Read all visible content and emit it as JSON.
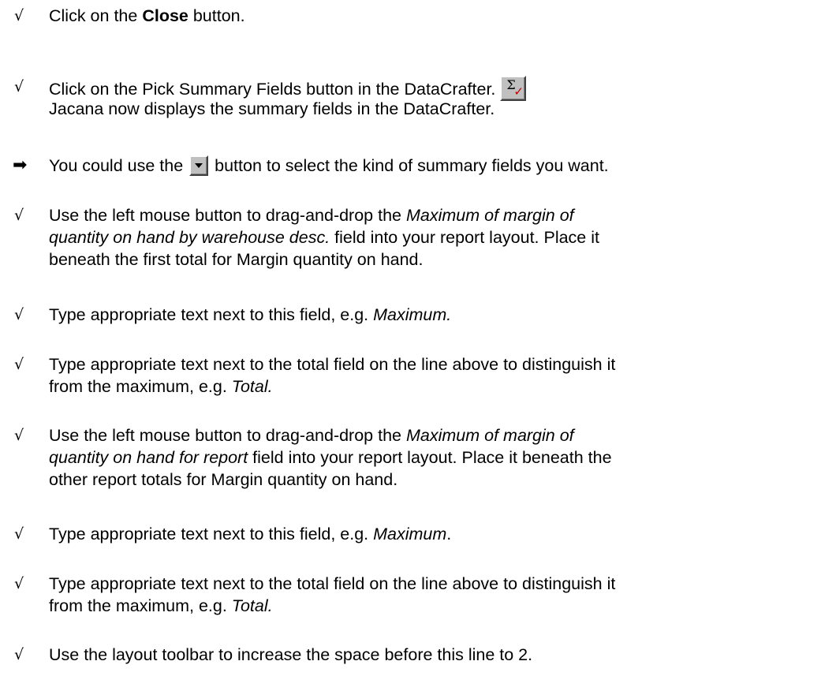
{
  "bullets": {
    "check": "√",
    "arrow": "➡"
  },
  "steps": {
    "s1": {
      "pre": "Click on the ",
      "bold": "Close",
      "post": " button."
    },
    "s2": {
      "line1": "Click on the Pick Summary Fields button in the DataCrafter.",
      "line2": "Jacana now displays the summary fields in the DataCrafter."
    },
    "tip": {
      "pre": "You could use the",
      "post": "button to select the kind of summary fields you want."
    },
    "s3": {
      "l1_pre": "Use the left mouse button to drag-and-drop the ",
      "l1_ital": "Maximum of margin of",
      "l2_ital": "quantity on hand by warehouse desc.",
      "l2_post": " field into your report layout. Place it",
      "line3": "beneath the first total for Margin quantity on hand."
    },
    "s4": {
      "pre": "Type appropriate text next to this field, e.g. ",
      "ital": "Maximum."
    },
    "s5": {
      "line1": "Type appropriate text next to the total field on the line above to distinguish it",
      "l2_pre": "from the maximum, e.g. ",
      "l2_ital": "Total."
    },
    "s6": {
      "l1_pre": "Use the left mouse button to drag-and-drop the ",
      "l1_ital": "Maximum of margin of",
      "l2_ital": "quantity on hand for report",
      "l2_post": " field into your report layout. Place it beneath the",
      "line3": "other report totals for Margin quantity on hand."
    },
    "s7": {
      "pre": "Type appropriate text next to this field, e.g. ",
      "ital": "Maximum",
      "post": "."
    },
    "s8": {
      "line1": "Type appropriate text next to the total field on the line above to distinguish it",
      "l2_pre": "from the maximum, e.g. ",
      "l2_ital": "Total."
    },
    "s9": {
      "text": "Use the layout toolbar to increase the space before this line to 2."
    }
  },
  "icons": {
    "sigma": {
      "glyph": "Σ",
      "check": "✓",
      "check_color": "#c00000",
      "name": "pick-summary-fields-icon"
    },
    "dropdown": {
      "name": "dropdown-arrow-icon"
    }
  }
}
